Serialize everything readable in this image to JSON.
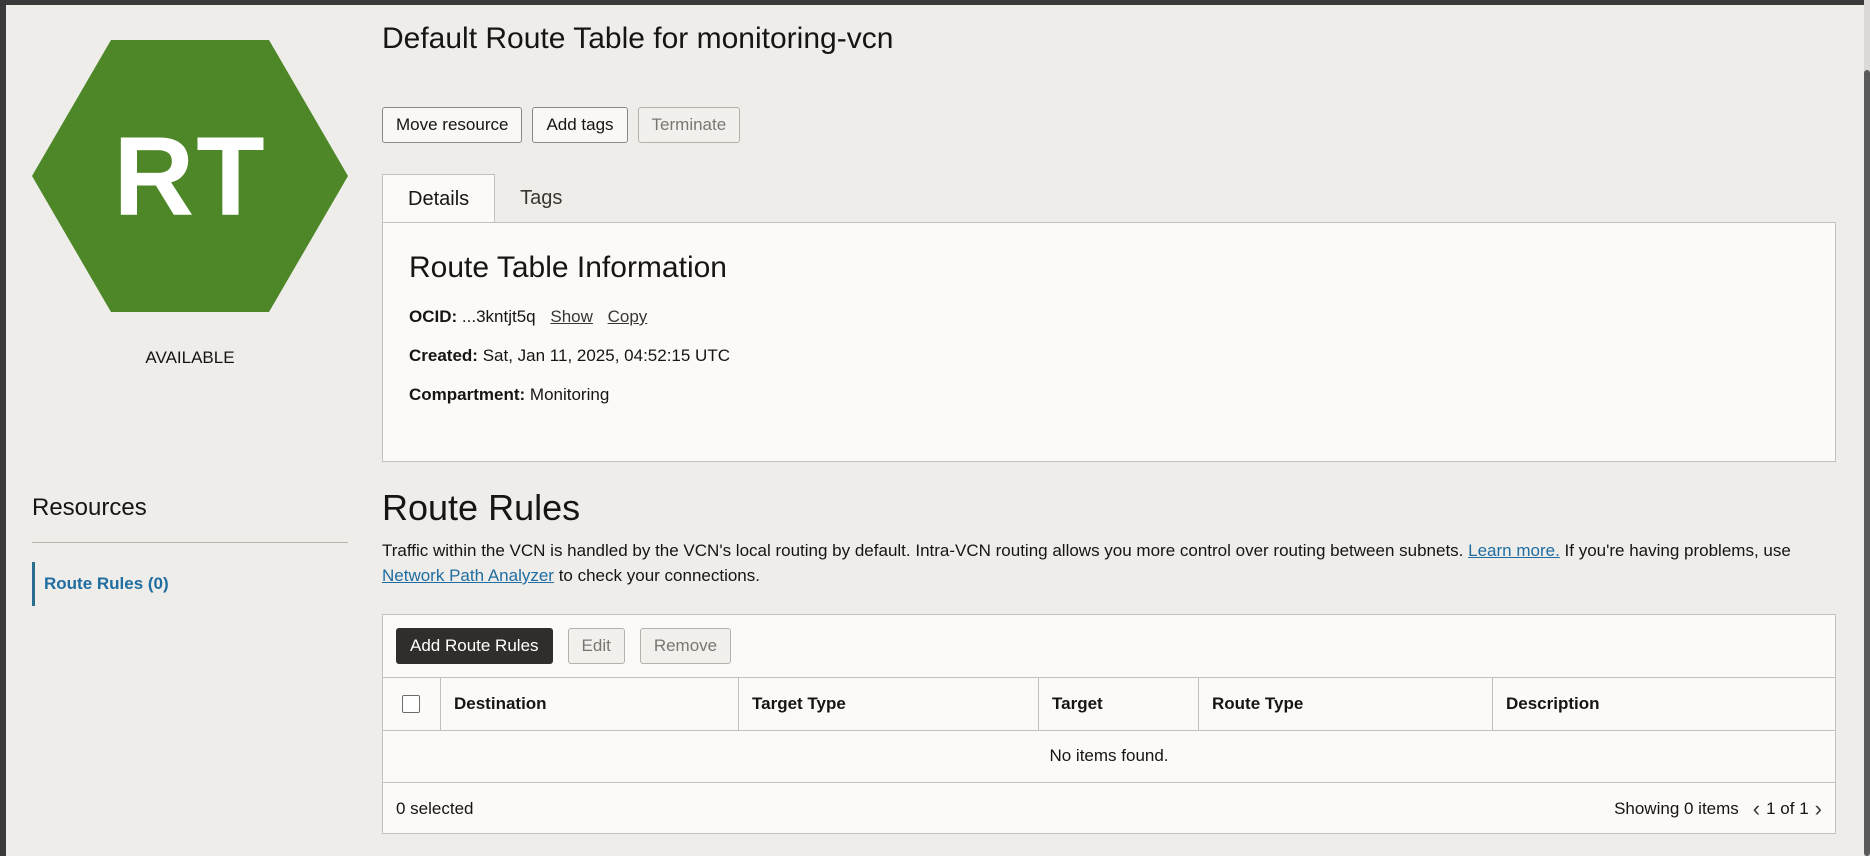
{
  "resource": {
    "icon_text": "RT",
    "icon_color": "#4e8728",
    "status": "AVAILABLE"
  },
  "sidebar": {
    "title": "Resources",
    "items": [
      {
        "label": "Route Rules (0)"
      }
    ]
  },
  "header": {
    "title": "Default Route Table for monitoring-vcn",
    "actions": {
      "move": "Move resource",
      "tags": "Add tags",
      "terminate": "Terminate"
    }
  },
  "tabs": [
    {
      "label": "Details"
    },
    {
      "label": "Tags"
    }
  ],
  "info": {
    "title": "Route Table Information",
    "ocid_label": "OCID:",
    "ocid_value": "...3kntjt5q",
    "show": "Show",
    "copy": "Copy",
    "created_label": "Created:",
    "created_value": "Sat, Jan 11, 2025, 04:52:15 UTC",
    "compartment_label": "Compartment:",
    "compartment_value": "Monitoring"
  },
  "route_rules": {
    "title": "Route Rules",
    "desc_1": "Traffic within the VCN is handled by the VCN's local routing by default. Intra-VCN routing allows you more control over routing between subnets.",
    "learn_more": "Learn more.",
    "desc_2": "If you're having problems, use",
    "analyzer_link": "Network Path Analyzer",
    "desc_3": "to check your connections.",
    "toolbar": {
      "add": "Add Route Rules",
      "edit": "Edit",
      "remove": "Remove"
    },
    "columns": [
      "Destination",
      "Target Type",
      "Target",
      "Route Type",
      "Description"
    ],
    "empty": "No items found.",
    "selected": "0 selected",
    "showing": "Showing 0 items",
    "page": "1 of 1"
  }
}
